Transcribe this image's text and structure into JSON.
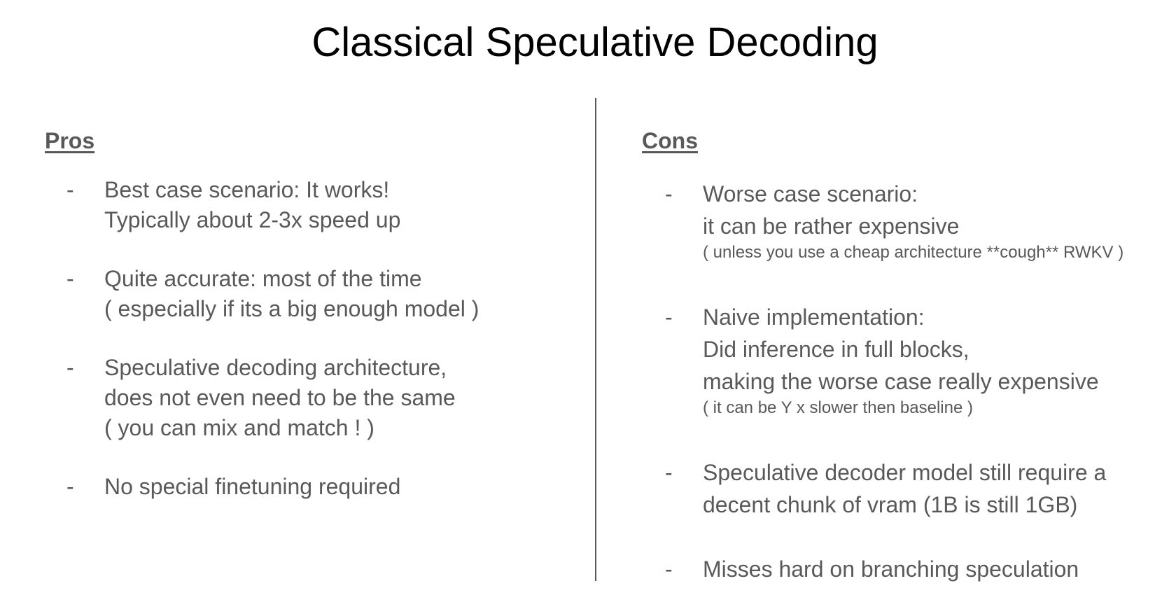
{
  "slide": {
    "title": "Classical Speculative Decoding"
  },
  "pros": {
    "heading": "Pros",
    "items": [
      {
        "bullet": "-",
        "lines": [
          "Best case scenario: It works!",
          "Typically about 2-3x speed up"
        ]
      },
      {
        "bullet": "-",
        "lines": [
          "Quite accurate: most of the time",
          "( especially if its a big enough model )"
        ]
      },
      {
        "bullet": "-",
        "lines": [
          "Speculative decoding architecture,",
          "does not even need to be the same",
          "( you can mix and match ! )"
        ]
      },
      {
        "bullet": "-",
        "lines": [
          "No special finetuning required"
        ]
      }
    ]
  },
  "cons": {
    "heading": "Cons",
    "items": [
      {
        "bullet": "-",
        "lines": [
          "Worse case scenario:",
          "it can be rather expensive"
        ],
        "note": "( unless you use a cheap architecture **cough**  RWKV )"
      },
      {
        "bullet": "-",
        "lines": [
          "Naive implementation:",
          "Did inference in full blocks,",
          "making the worse case really expensive"
        ],
        "note": "( it can be Y x slower then baseline )"
      },
      {
        "bullet": "-",
        "lines": [
          "Speculative decoder model still require a",
          "decent chunk of vram (1B is still 1GB)"
        ]
      },
      {
        "bullet": "-",
        "lines": [
          "Misses hard on branching speculation"
        ]
      }
    ]
  }
}
